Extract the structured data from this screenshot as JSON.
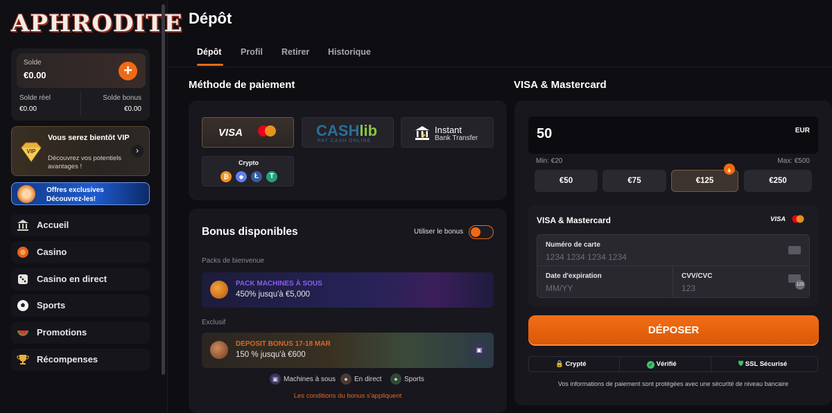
{
  "brand": {
    "logo": "APHRODITE",
    "accent": "#f06a16"
  },
  "sidebar": {
    "balance": {
      "label": "Solde",
      "value": "€0.00",
      "real_label": "Solde réel",
      "real_value": "€0.00",
      "bonus_label": "Solde bonus",
      "bonus_value": "€0.00"
    },
    "vip": {
      "title": "Vous serez bientôt VIP",
      "subtitle": "Découvrez vos potentiels avantages !",
      "badge": "VIP"
    },
    "offer": {
      "title": "Offres exclusives",
      "subtitle": "Découvrez-les!"
    },
    "nav": [
      {
        "label": "Accueil",
        "icon": "temple-icon"
      },
      {
        "label": "Casino",
        "icon": "chip-icon"
      },
      {
        "label": "Casino en direct",
        "icon": "dice-icon"
      },
      {
        "label": "Sports",
        "icon": "soccer-ball-icon"
      },
      {
        "label": "Promotions",
        "icon": "watermelon-icon"
      },
      {
        "label": "Récompenses",
        "icon": "trophy-icon"
      }
    ]
  },
  "page": {
    "title": "Dépôt",
    "tabs": [
      "Dépôt",
      "Profil",
      "Retirer",
      "Historique"
    ]
  },
  "payment": {
    "section_title": "Méthode de paiement",
    "methods": {
      "visa": "VISA",
      "cashlib_a": "CASH",
      "cashlib_b": "lib",
      "cashlib_tag": "PAY CASH ONLINE",
      "instant_a": "Instant",
      "instant_b": "Bank Transfer",
      "crypto": "Crypto"
    }
  },
  "bonus": {
    "title": "Bonus disponibles",
    "toggle_label": "Utiliser le bonus",
    "welcome_label": "Packs de bienvenue",
    "welcome": {
      "title": "PACK MACHINES À SOUS",
      "desc": "450% jusqu'à €5,000"
    },
    "exclusive_label": "Exclusif",
    "exclusive": {
      "title": "DEPOSIT BONUS 17-18 MAR",
      "desc": "150 % jusqu'à €600"
    },
    "categories": [
      "Machines à sous",
      "En direct",
      "Sports"
    ],
    "terms": "Les conditions du bonus s'appliquent"
  },
  "deposit": {
    "section_title": "VISA & Mastercard",
    "amount": "50",
    "currency": "EUR",
    "min": "Min: €20",
    "max": "Max: €500",
    "quick_amounts": [
      "€50",
      "€75",
      "€125",
      "€250"
    ],
    "card_form": {
      "title": "VISA & Mastercard",
      "visa_small": "VISA",
      "card_number_label": "Numéro de carte",
      "card_number_placeholder": "1234 1234 1234 1234",
      "expiry_label": "Date d'expiration",
      "expiry_placeholder": "MM/YY",
      "cvv_label": "CVV/CVC",
      "cvv_placeholder": "123",
      "cvv_badge": "123"
    },
    "submit": "DÉPOSER",
    "trust": [
      "Crypté",
      "Vérifié",
      "SSL Sécurisé"
    ],
    "note": "Vos informations de paiement sont protégées avec une sécurité de niveau bancaire"
  }
}
